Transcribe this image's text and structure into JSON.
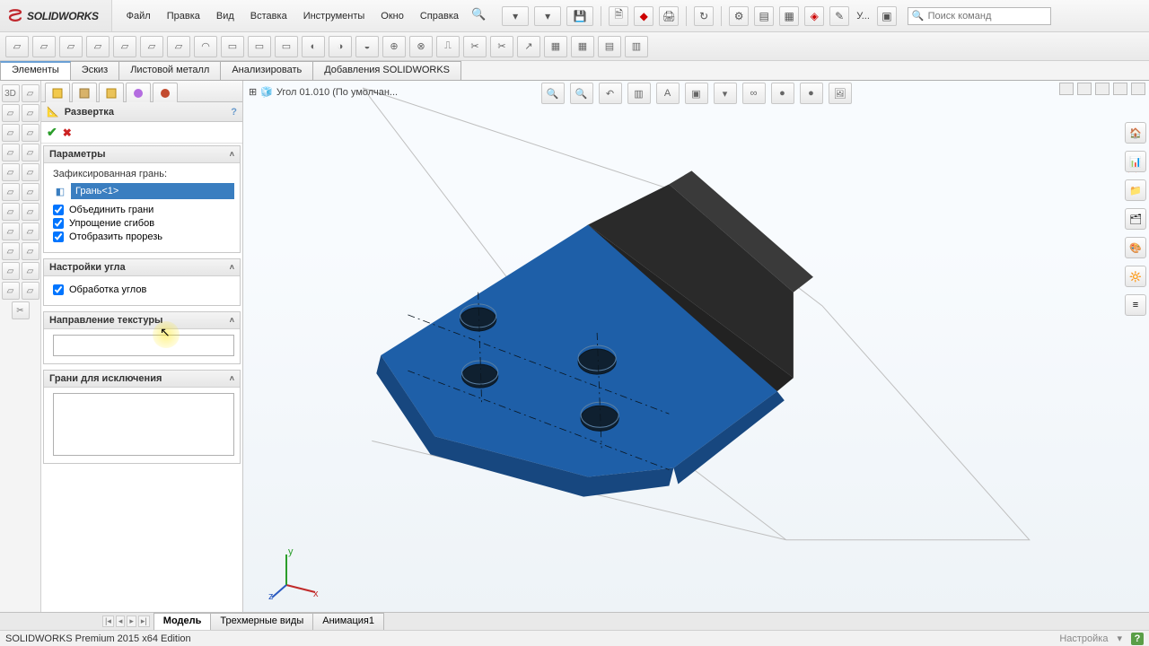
{
  "app": {
    "name": "SOLIDWORKS"
  },
  "menu": {
    "items": [
      "Файл",
      "Правка",
      "Вид",
      "Вставка",
      "Инструменты",
      "Окно",
      "Справка"
    ]
  },
  "search": {
    "placeholder": "Поиск команд"
  },
  "tabs": {
    "items": [
      "Элементы",
      "Эскиз",
      "Листовой металл",
      "Анализировать",
      "Добавления SOLIDWORKS"
    ],
    "active": 0
  },
  "doc": {
    "title": "Угол 01.010  (По умолчан..."
  },
  "panel": {
    "title": "Развертка",
    "help": "?",
    "groups": {
      "params": {
        "label": "Параметры",
        "fixed_face_label": "Зафиксированная грань:",
        "selection": "Грань<1>",
        "merge_faces": "Объединить грани",
        "simplify_bends": "Упрощение сгибов",
        "show_slot": "Отобразить прорезь"
      },
      "angle": {
        "label": "Настройки угла",
        "corner_treatment": "Обработка углов"
      },
      "texture": {
        "label": "Направление текстуры"
      },
      "exclude": {
        "label": "Грани для исключения"
      }
    }
  },
  "bottom_tabs": {
    "items": [
      "Модель",
      "Трехмерные виды",
      "Анимация1"
    ],
    "active": 0
  },
  "status": {
    "left": "SOLIDWORKS Premium 2015 x64 Edition",
    "setting": "Настройка"
  },
  "colors": {
    "face_blue": "#1e5fa8",
    "face_dark": "#2d2d2d",
    "accent": "#3a7ec0",
    "ok": "#2a9d2a",
    "cancel": "#d22"
  }
}
